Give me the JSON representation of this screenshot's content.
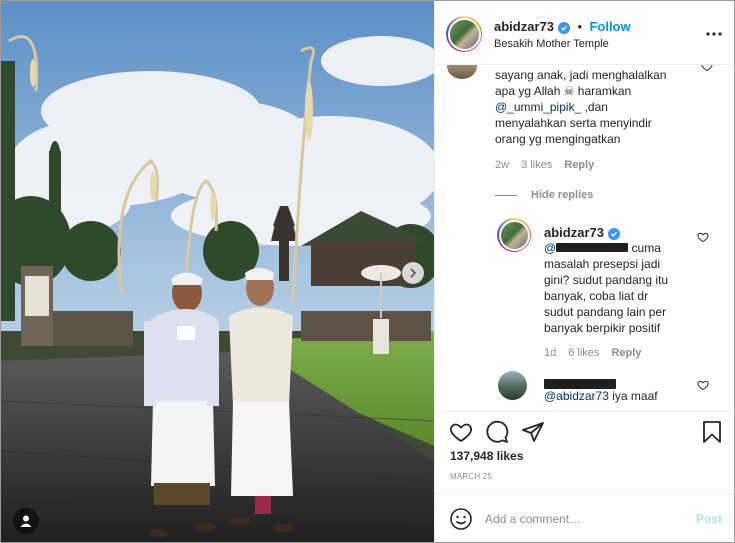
{
  "post": {
    "username": "abidzar73",
    "follow_label": "Follow",
    "location": "Besakih Mother Temple",
    "verified_color": "#3897f0",
    "accent": "#0095f6"
  },
  "comments": {
    "top": {
      "lines": [
        "sayang anak, jadi menghalalkan",
        "apa yg Allah ☠ haramkan"
      ],
      "mention": "@_ummi_pipik_",
      "rest": [
        ",dan",
        "menyalahkan serta menyindir",
        "orang yg mengingatkan"
      ],
      "time": "2w",
      "likes": "3 likes",
      "reply_label": "Reply"
    },
    "hide_replies_label": "Hide replies",
    "reply1": {
      "username": "abidzar73",
      "mention": "@",
      "text_first": "cuma",
      "lines": [
        "masalah presepsi jadi",
        "gini? sudut pandang itu",
        "banyak, coba liat dr",
        "sudut pandang lain per",
        "banyak berpikir positif"
      ],
      "time": "1d",
      "likes": "6 likes",
      "reply_label": "Reply"
    },
    "reply2": {
      "mention": "@abidzar73",
      "text": "iya maaf"
    }
  },
  "actions": {
    "likes": "137,948 likes",
    "date": "MARCH 25"
  },
  "comment_box": {
    "placeholder": "Add a comment…",
    "post_label": "Post"
  }
}
